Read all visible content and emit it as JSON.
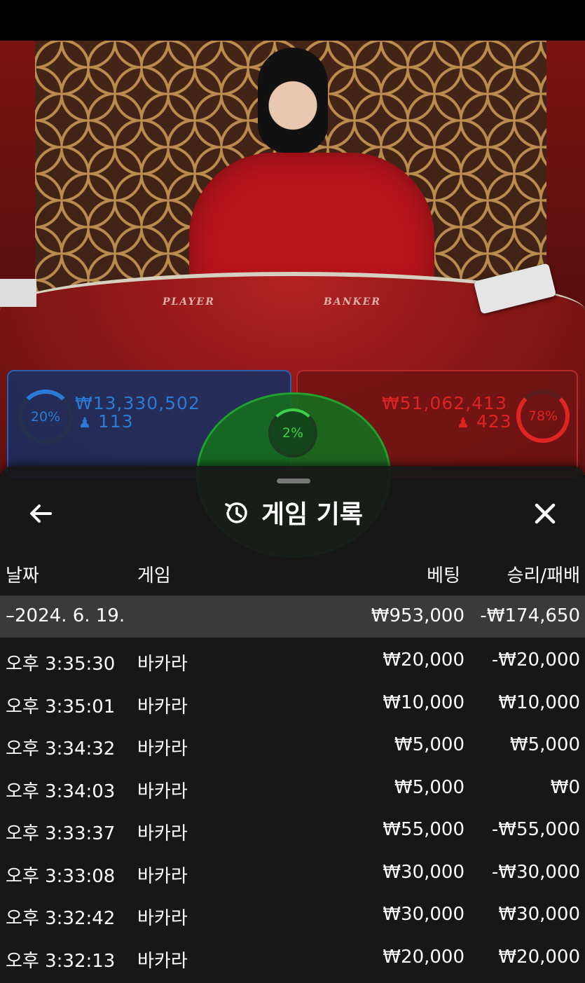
{
  "live": {
    "felt_labels": {
      "player": "PLAYER",
      "banker": "BANKER"
    },
    "player": {
      "percent": "20%",
      "amount": "₩13,330,502",
      "count": "113",
      "color": "#2b7bd6"
    },
    "banker": {
      "percent": "78%",
      "amount": "₩51,062,413",
      "count": "423",
      "color": "#e02424"
    },
    "tie": {
      "percent": "2%",
      "color": "#3cd04a"
    }
  },
  "panel": {
    "title": "게임 기록",
    "icons": {
      "back": "arrow-left-icon",
      "title": "history-icon",
      "close": "close-icon"
    },
    "columns": {
      "date": "날짜",
      "game": "게임",
      "bet": "베팅",
      "result": "승리/패배"
    },
    "summary": {
      "date": "–2024. 6. 19.",
      "bet": "₩953,000",
      "result": "-₩174,650"
    },
    "rows": [
      {
        "time": "오후 3:35:30",
        "game": "바카라",
        "bet": "₩20,000",
        "result": "-₩20,000"
      },
      {
        "time": "오후 3:35:01",
        "game": "바카라",
        "bet": "₩10,000",
        "result": "₩10,000"
      },
      {
        "time": "오후 3:34:32",
        "game": "바카라",
        "bet": "₩5,000",
        "result": "₩5,000"
      },
      {
        "time": "오후 3:34:03",
        "game": "바카라",
        "bet": "₩5,000",
        "result": "₩0"
      },
      {
        "time": "오후 3:33:37",
        "game": "바카라",
        "bet": "₩55,000",
        "result": "-₩55,000"
      },
      {
        "time": "오후 3:33:08",
        "game": "바카라",
        "bet": "₩30,000",
        "result": "-₩30,000"
      },
      {
        "time": "오후 3:32:42",
        "game": "바카라",
        "bet": "₩30,000",
        "result": "₩30,000"
      },
      {
        "time": "오후 3:32:13",
        "game": "바카라",
        "bet": "₩20,000",
        "result": "₩20,000"
      }
    ]
  }
}
